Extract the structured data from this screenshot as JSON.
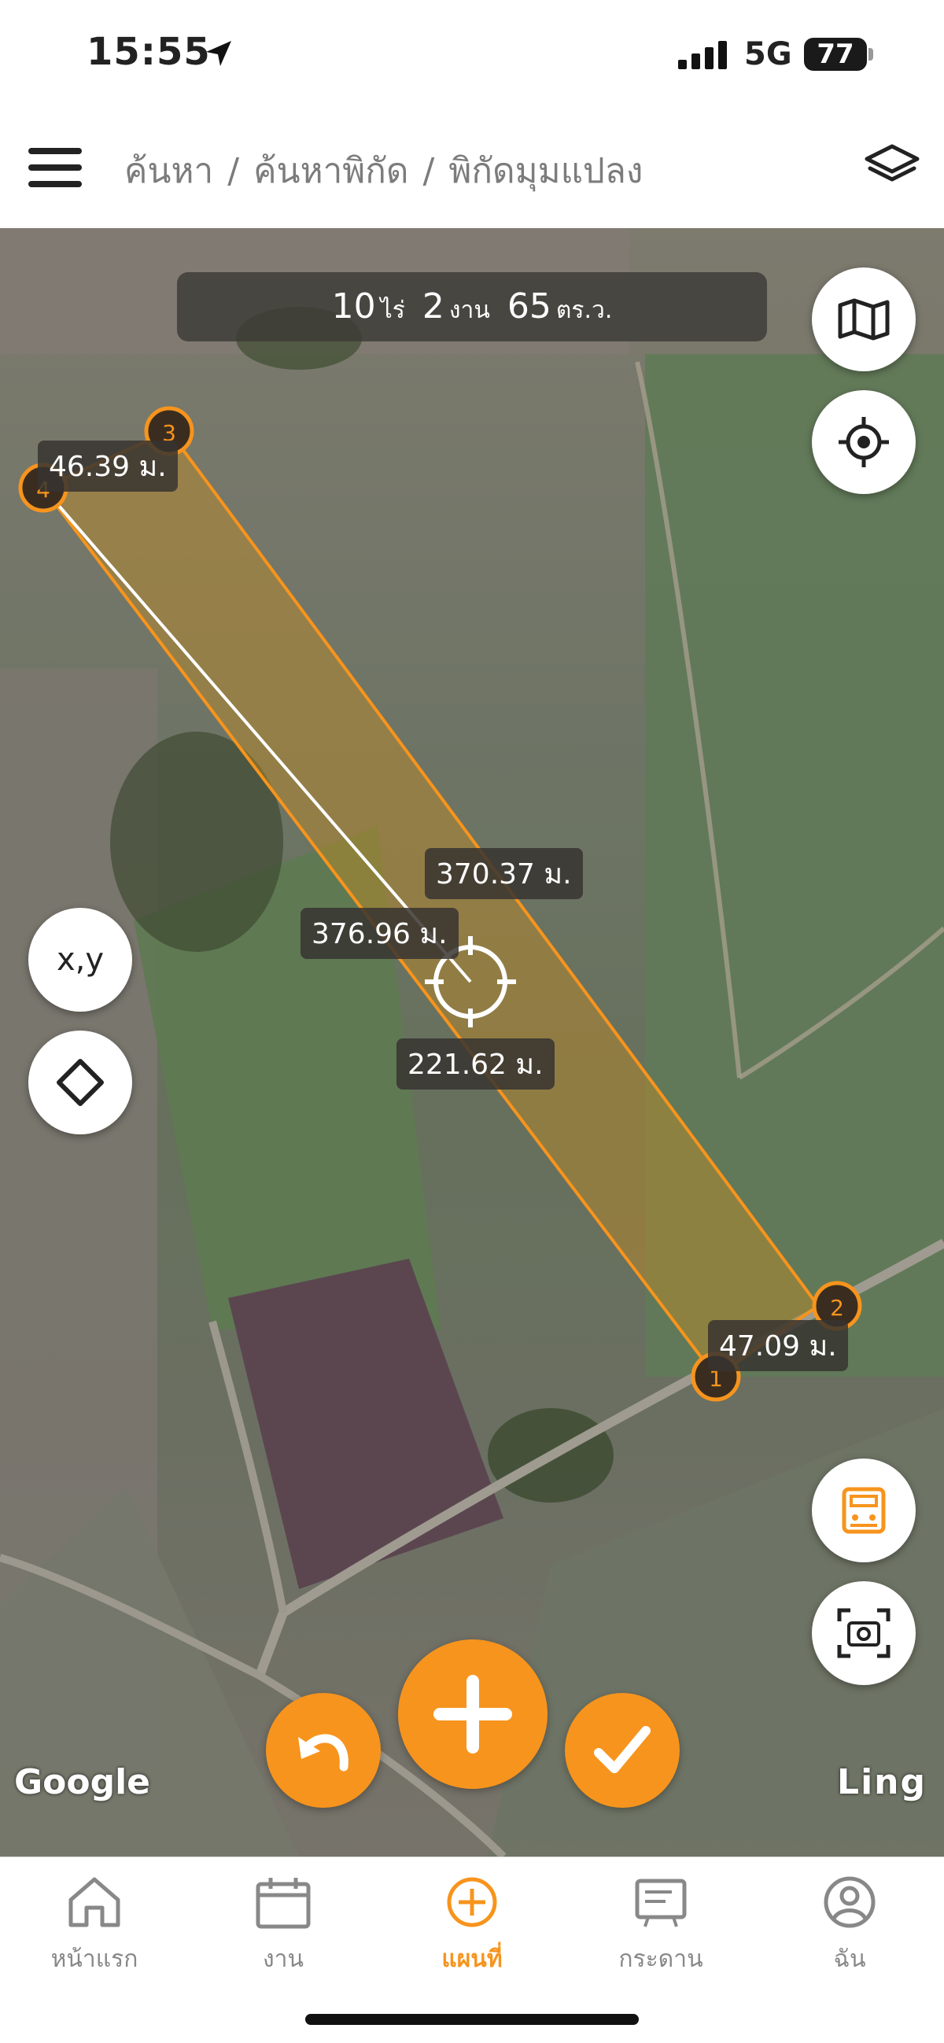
{
  "status_bar": {
    "time": "15:55",
    "network": "5G",
    "battery": "77"
  },
  "header": {
    "breadcrumb": [
      "ค้นหา",
      "ค้นหาพิกัด",
      "พิกัดมุมแปลง"
    ],
    "separator": "/"
  },
  "map": {
    "area": {
      "rai": "10",
      "rai_unit": "ไร่",
      "ngan": "2",
      "ngan_unit": "งาน",
      "wa": "65",
      "wa_unit": "ตร.ว."
    },
    "distances": [
      "46.39 ม.",
      "370.37 ม.",
      "376.96 ม.",
      "221.62 ม.",
      "47.09 ม."
    ],
    "points": [
      "1",
      "2",
      "3",
      "4"
    ],
    "xy_button": "x,y",
    "attribution": "Google",
    "watermark": "Ling",
    "accent_color": "#f7941d"
  },
  "tabs": [
    {
      "label": "หน้าแรก",
      "icon": "home-icon"
    },
    {
      "label": "งาน",
      "icon": "calendar-icon"
    },
    {
      "label": "แผนที่",
      "icon": "plus-circle-icon",
      "active": true
    },
    {
      "label": "กระดาน",
      "icon": "board-icon"
    },
    {
      "label": "ฉัน",
      "icon": "profile-icon"
    }
  ]
}
